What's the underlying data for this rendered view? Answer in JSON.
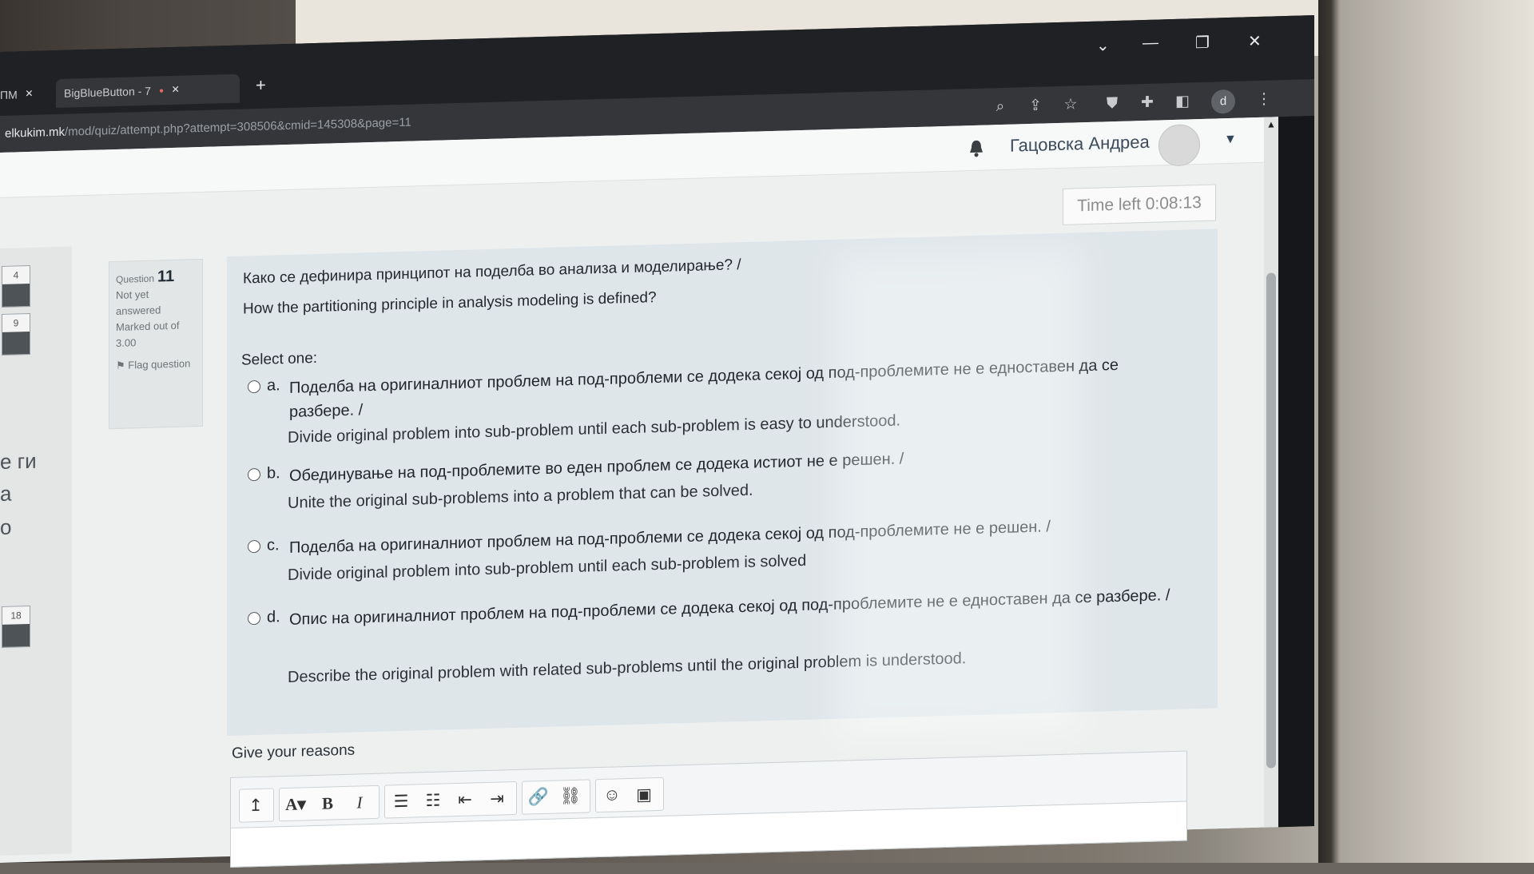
{
  "browser": {
    "tabs": [
      {
        "label": "ПМ"
      },
      {
        "label": "BigBlueButton - 7"
      }
    ],
    "new_tab": "+",
    "url_host": "elkukim.mk",
    "url_path": "/mod/quiz/attempt.php?attempt=308506&cmid=145308&page=11",
    "profile_initial": "d",
    "window_controls": [
      "⌄",
      "—",
      "❐",
      "✕"
    ]
  },
  "header": {
    "username": "Гацовска Андреа"
  },
  "timer": "Time left 0:08:13",
  "left_nav": {
    "boxes": [
      "4",
      "9",
      "18"
    ],
    "fragments": [
      "е ги",
      "а",
      "о"
    ]
  },
  "question_info": {
    "question_label": "Question",
    "number": "11",
    "status": "Not yet answered",
    "marks": "Marked out of 3.00",
    "flag_label": "Flag question"
  },
  "question": {
    "text_mk": "Како се дефинира принципот на поделба во анализа и моделирање? /",
    "text_en": "How the partitioning principle in analysis modeling is defined?",
    "select_label": "Select one:",
    "options": [
      {
        "letter": "a.",
        "mk": "Поделба на оригиналниот проблем на под-проблеми се додека секој од под-проблемите не е едноставен да се разбере. /",
        "en": "Divide original problem into sub-problem until each sub-problem is easy to understood."
      },
      {
        "letter": "b.",
        "mk": "Обединување на под-проблемите во еден проблем се додека истиот не е решен. /",
        "en": "Unite the original sub-problems into a problem that can be solved."
      },
      {
        "letter": "c.",
        "mk": "Поделба на оригиналниот проблем на под-проблеми се додека секој од под-проблемите не е решен. /",
        "en": "Divide original problem into sub-problem until each sub-problem is solved"
      },
      {
        "letter": "d.",
        "mk": "Опис на оригиналниот проблем на под-проблеми се додека секој од под-проблемите не е едноставен да се разбере. /",
        "en": "Describe the original problem with related sub-problems until the original problem is understood."
      }
    ]
  },
  "reasons": {
    "label": "Give your reasons",
    "toolbar": {
      "collapse": "↥",
      "font": "A▾",
      "bold": "B",
      "italic": "I",
      "bullets": "☰",
      "numbered": "☷",
      "indent_less": "⇤",
      "indent_more": "⇥",
      "link": "🔗",
      "unlink": "⛓",
      "emoji": "☺",
      "image": "▣"
    }
  }
}
